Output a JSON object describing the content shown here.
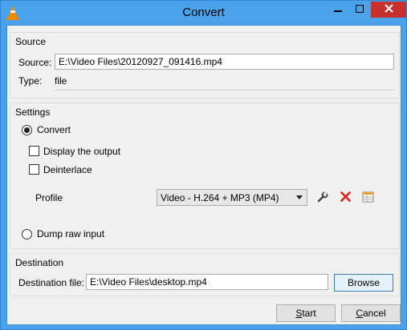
{
  "window": {
    "title": "Convert"
  },
  "source": {
    "group_title": "Source",
    "source_label": "Source:",
    "source_value": "E:\\Video Files\\20120927_091416.mp4",
    "type_label": "Type:",
    "type_value": "file"
  },
  "settings": {
    "group_title": "Settings",
    "convert_label": "Convert",
    "display_output_label": "Display the output",
    "deinterlace_label": "Deinterlace",
    "profile_label": "Profile",
    "profile_selected": "Video - H.264 + MP3 (MP4)",
    "dump_raw_label": "Dump raw input"
  },
  "destination": {
    "group_title": "Destination",
    "file_label": "Destination file:",
    "file_value": "E:\\Video Files\\desktop.mp4",
    "browse_label": "Browse"
  },
  "footer": {
    "start_first": "S",
    "start_rest": "tart",
    "cancel_first": "C",
    "cancel_rest": "ancel"
  },
  "colors": {
    "title_bar": "#4aa3ea",
    "close_button": "#c7312d",
    "delete_icon": "#d9211c"
  }
}
